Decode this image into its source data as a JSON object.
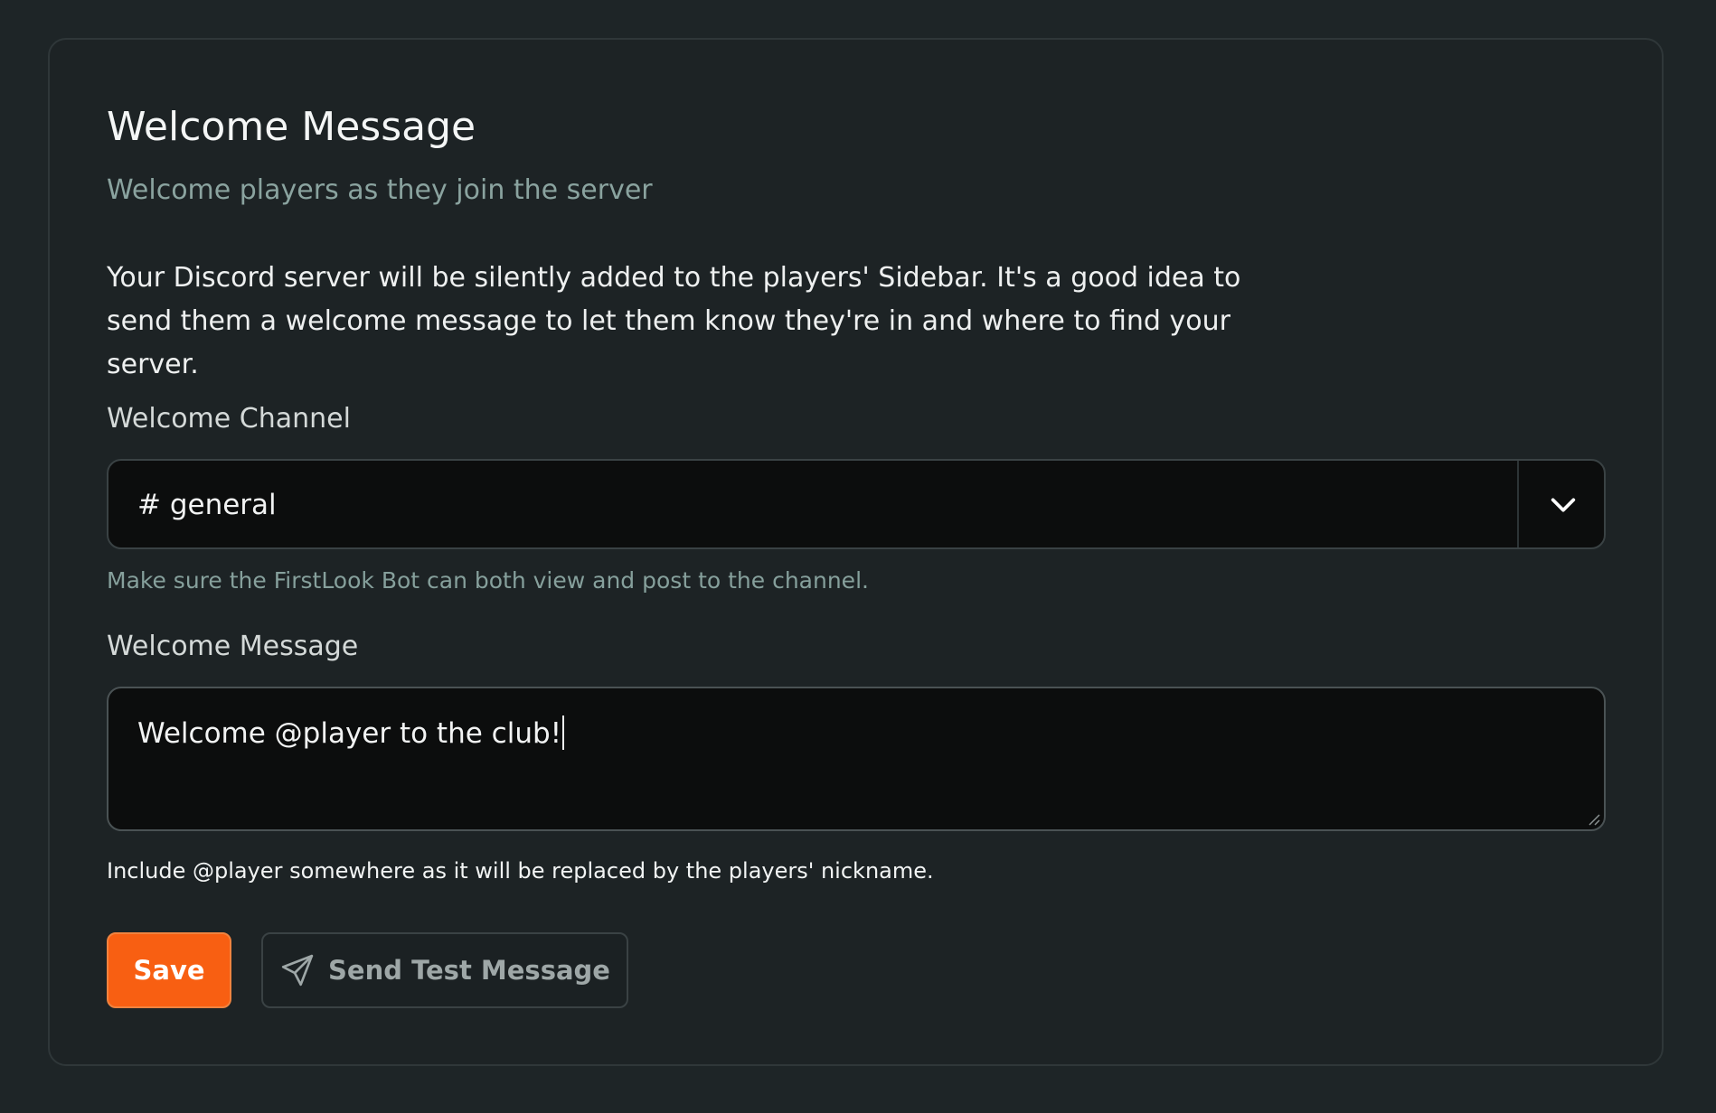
{
  "card": {
    "title": "Welcome Message",
    "subtitle": "Welcome players as they join the server",
    "description": "Your Discord server will be silently added to the players' Sidebar. It's a good idea to send them a welcome message to let them know they're in and where to find your server."
  },
  "channel": {
    "label": "Welcome Channel",
    "selected": "# general",
    "help": "Make sure the FirstLook Bot can both view and post to the channel."
  },
  "message": {
    "label": "Welcome Message",
    "value": "Welcome @player to the club!",
    "help": "Include @player somewhere as it will be replaced by the players' nickname."
  },
  "actions": {
    "save_label": "Save",
    "test_label": "Send Test Message",
    "test_icon": "send-icon"
  },
  "colors": {
    "background": "#1e2527",
    "accent": "#f85f12",
    "muted_teal": "#8aa39f"
  }
}
